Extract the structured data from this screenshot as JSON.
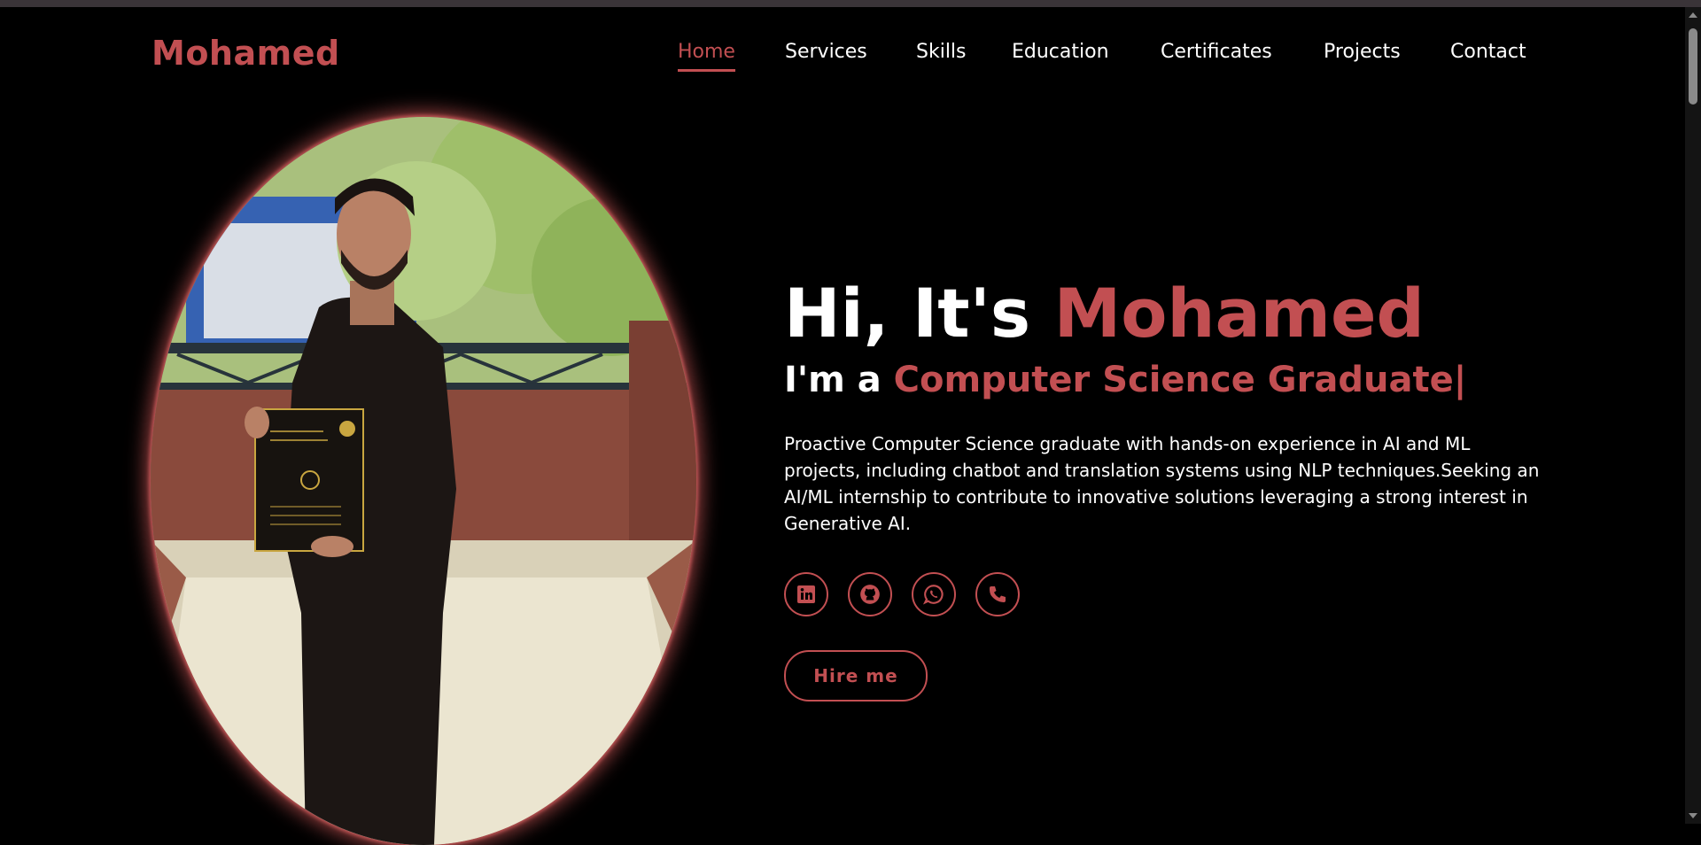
{
  "brand": {
    "logo": "Mohamed",
    "accent_color": "#c24f52"
  },
  "nav": {
    "items": [
      {
        "label": "Home",
        "active": true
      },
      {
        "label": "Services",
        "active": false
      },
      {
        "label": "Skills",
        "active": false
      },
      {
        "label": "Education",
        "active": false
      },
      {
        "label": "Certificates",
        "active": false
      },
      {
        "label": "Projects",
        "active": false
      },
      {
        "label": "Contact",
        "active": false
      }
    ]
  },
  "hero": {
    "greeting": "Hi, It's",
    "name": "Mohamed",
    "role_prefix": "I'm a",
    "role": "Computer Science Graduate",
    "cursor": "|",
    "bio": "Proactive Computer Science graduate with hands-on experience in AI and ML projects, including chatbot and translation systems using NLP techniques.Seeking an AI/ML internship to contribute to innovative solutions leveraging a strong interest in Generative AI.",
    "socials": [
      "linkedin-icon",
      "github-icon",
      "whatsapp-icon",
      "phone-icon"
    ],
    "cta_label": "Hire me"
  }
}
